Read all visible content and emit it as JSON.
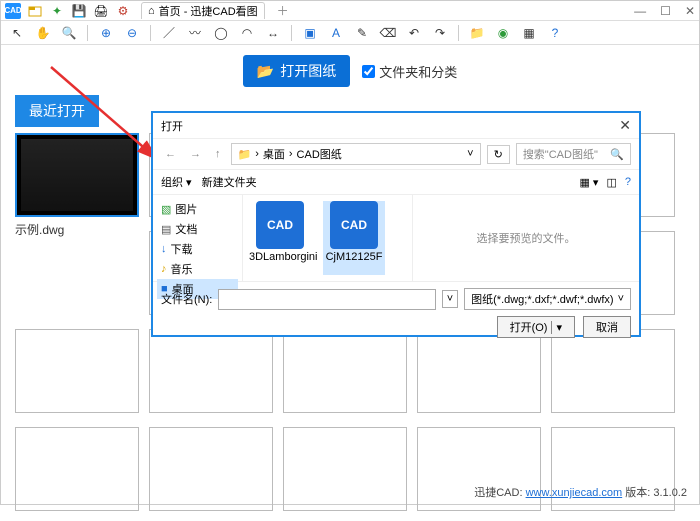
{
  "titlebar": {
    "tab_label": "首页 - 迅捷CAD看图",
    "logo_text": "CAD"
  },
  "page": {
    "open_btn": "打开图纸",
    "folder_check": "文件夹和分类",
    "recent_tab": "最近打开",
    "sample_filename": "示例.dwg"
  },
  "dialog": {
    "title": "打开",
    "path_seg1": "桌面",
    "path_seg2": "CAD图纸",
    "search_placeholder": "搜索\"CAD图纸\"",
    "organize": "组织",
    "newfolder": "新建文件夹",
    "preview_hint": "选择要预览的文件。",
    "filename_label": "文件名(N):",
    "filter": "图纸(*.dwg;*.dxf;*.dwf;*.dwfx)",
    "open_btn": "打开(O)",
    "cancel_btn": "取消",
    "side": {
      "pictures": "图片",
      "documents": "文档",
      "downloads": "下载",
      "music": "音乐",
      "desktop": "桌面"
    },
    "files": {
      "f1": "3DLamborgini",
      "f2": "CjM12125F"
    }
  },
  "footer": {
    "brand": "迅捷CAD:",
    "url": "www.xunjiecad.com",
    "version": "版本: 3.1.0.2"
  }
}
